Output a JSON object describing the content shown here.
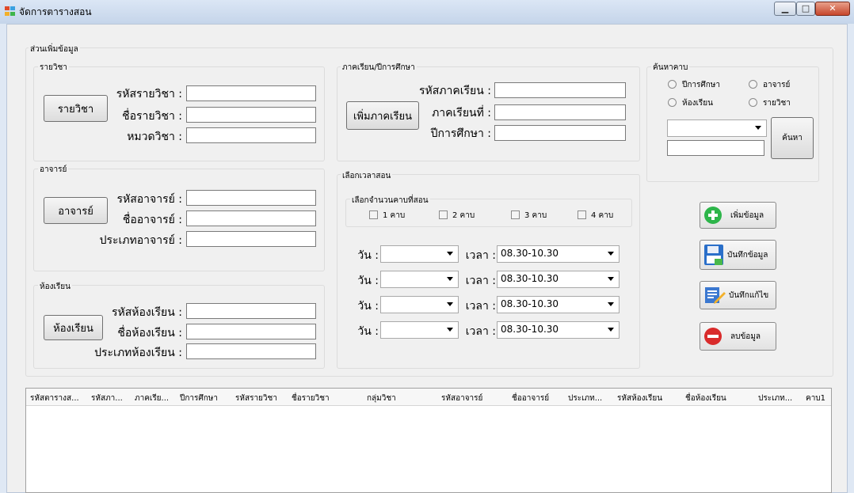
{
  "window": {
    "title": "จัดการตารางสอน"
  },
  "group_add": {
    "legend": "ส่วนเพิ่มข้อมูล"
  },
  "subject": {
    "legend": "รายวิชา",
    "button": "รายวิชา",
    "code_label": "รหัสรายวิชา :",
    "name_label": "ชื่อรายวิชา :",
    "category_label": "หมวดวิชา :",
    "code_value": "",
    "name_value": "",
    "category_value": ""
  },
  "teacher": {
    "legend": "อาจารย์",
    "button": "อาจารย์",
    "code_label": "รหัสอาจารย์ :",
    "name_label": "ชื่ออาจารย์ :",
    "type_label": "ประเภทอาจารย์ :",
    "code_value": "",
    "name_value": "",
    "type_value": ""
  },
  "room": {
    "legend": "ห้องเรียน",
    "button": "ห้องเรียน",
    "code_label": "รหัสห้องเรียน :",
    "name_label": "ชื่อห้องเรียน :",
    "type_label": "ประเภทห้องเรียน :",
    "code_value": "",
    "name_value": "",
    "type_value": ""
  },
  "semester": {
    "legend": "ภาคเรียน/ปีการศึกษา",
    "button": "เพิ่มภาคเรียน",
    "code_label": "รหัสภาคเรียน :",
    "term_label": "ภาคเรียนที่ :",
    "year_label": "ปีการศึกษา :",
    "code_value": "",
    "term_value": "",
    "year_value": ""
  },
  "time": {
    "legend": "เลือกเวลาสอน",
    "periods_legend": "เลือกจำนวนคาบที่สอน",
    "periods": [
      "1 คาบ",
      "2 คาบ",
      "3 คาบ",
      "4 คาบ"
    ],
    "day_label": "วัน :",
    "time_label": "เวลา :",
    "rows": [
      {
        "day": "",
        "time": "08.30-10.30"
      },
      {
        "day": "",
        "time": "08.30-10.30"
      },
      {
        "day": "",
        "time": "08.30-10.30"
      },
      {
        "day": "",
        "time": "08.30-10.30"
      }
    ]
  },
  "search": {
    "legend": "ค้นหาคาบ",
    "options": [
      "ปีการศึกษา",
      "อาจารย์",
      "ห้องเรียน",
      "รายวิชา"
    ],
    "combo_value": "",
    "text_value": "",
    "button": "ค้นหา"
  },
  "actions": {
    "add": "เพิ่มข้อมูล",
    "save": "บันทึกข้อมูล",
    "save_edit": "บันทึกแก้ไข",
    "delete": "ลบข้อมูล"
  },
  "colors": {
    "add_icon": "#2db54a",
    "delete_icon": "#d92b2b",
    "save_icon": "#2a6fc9"
  },
  "icons": {
    "add": "plus-circle-icon",
    "save": "floppy-disk-icon",
    "save_edit": "edit-document-icon",
    "delete": "minus-circle-icon"
  },
  "grid": {
    "columns": [
      "รหัสตารางส...",
      "รหัสภา...",
      "ภาคเรีย...",
      "ปีการศึกษา",
      "รหัสรายวิชา",
      "ชื่อรายวิชา",
      "กลุ่มวิชา",
      "รหัสอาจารย์",
      "ชื่ออาจารย์",
      "ประเภท...",
      "รหัสห้องเรียน",
      "ชื่อห้องเรียน",
      "ประเภท...",
      "คาบ1"
    ],
    "rows": []
  }
}
